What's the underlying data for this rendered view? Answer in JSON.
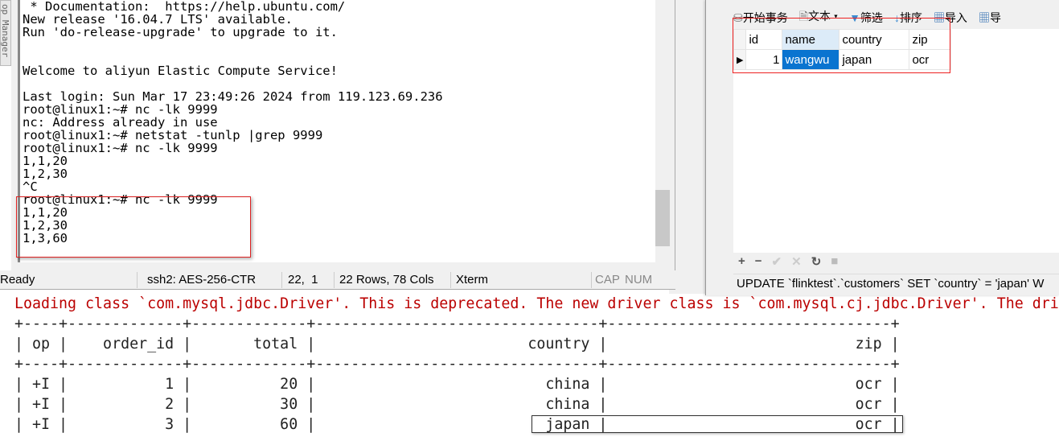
{
  "sidebar_tab": "op Manager",
  "terminal": {
    "lines": [
      " * Documentation:  https://help.ubuntu.com/",
      "New release '16.04.7 LTS' available.",
      "Run 'do-release-upgrade' to upgrade to it.",
      "",
      "",
      "Welcome to aliyun Elastic Compute Service!",
      "",
      "Last login: Sun Mar 17 23:49:26 2024 from 119.123.69.236",
      "root@linux1:~# nc -lk 9999",
      "nc: Address already in use",
      "root@linux1:~# netstat -tunlp |grep 9999",
      "root@linux1:~# nc -lk 9999",
      "1,1,20",
      "1,2,30",
      "^C",
      "root@linux1:~# nc -lk 9999",
      "1,1,20",
      "1,2,30",
      "1,3,60"
    ],
    "status": {
      "state": "Ready",
      "cipher": "ssh2: AES-256-CTR",
      "cursor": "22,  1",
      "size": "22 Rows, 78 Cols",
      "term": "Xterm",
      "cap": "CAP",
      "num": "NUM"
    }
  },
  "navicat": {
    "toolbar": [
      "开始事务",
      "文本",
      "筛选",
      "排序",
      "导入",
      "导"
    ],
    "columns": [
      "id",
      "name",
      "country",
      "zip"
    ],
    "rows": [
      [
        "1",
        "wangwu",
        "japan",
        "ocr"
      ]
    ],
    "buttons": [
      "+",
      "−",
      "✔",
      "✕",
      "↻",
      "■"
    ],
    "sql": "UPDATE `flinktest`.`customers` SET `country` = 'japan' W"
  },
  "console": {
    "warning": "Loading class `com.mysql.jdbc.Driver'. This is deprecated. The new driver class is `com.mysql.cj.jdbc.Driver'. The dri",
    "columns": [
      "op",
      "order_id",
      "total",
      "country",
      "zip"
    ],
    "rows": [
      [
        "+I",
        "1",
        "20",
        "china",
        "ocr"
      ],
      [
        "+I",
        "2",
        "30",
        "china",
        "ocr"
      ],
      [
        "+I",
        "3",
        "60",
        "japan",
        "ocr"
      ]
    ]
  }
}
